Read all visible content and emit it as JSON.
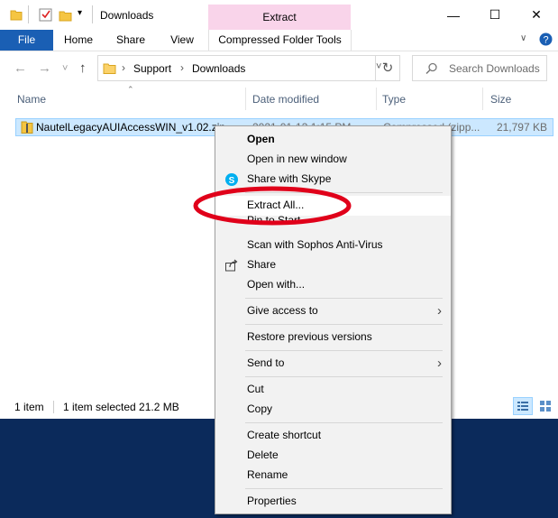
{
  "window": {
    "title": "Downloads",
    "context_header": "Extract",
    "minimize": "—",
    "maximize": "☐",
    "close": "✕"
  },
  "ribbon": {
    "file": "File",
    "home": "Home",
    "share": "Share",
    "view": "View",
    "compressed": "Compressed Folder Tools"
  },
  "address": {
    "back": "←",
    "forward": "→",
    "recent": "˅",
    "up": "↑",
    "crumbs": [
      "Support",
      "Downloads"
    ],
    "sep": "›",
    "dropdown": "˅",
    "refresh": "↻",
    "search_placeholder": "Search Downloads"
  },
  "columns": {
    "name": "Name",
    "date": "Date modified",
    "type": "Type",
    "size": "Size"
  },
  "file": {
    "name": "NautelLegacyAUIAccessWIN_v1.02.zip",
    "date": "2021-01-13 1:15 PM",
    "type": "Compressed (zipp...",
    "size": "21,797 KB"
  },
  "status": {
    "count": "1 item",
    "selected": "1 item selected  21.2 MB"
  },
  "menu": {
    "open": "Open",
    "open_new_window": "Open in new window",
    "share_skype": "Share with Skype",
    "extract_all": "Extract All...",
    "pin_start": "Pin to Start",
    "scan": "Scan with Sophos Anti-Virus",
    "share": "Share",
    "open_with": "Open with...",
    "give_access": "Give access to",
    "restore": "Restore previous versions",
    "send_to": "Send to",
    "cut": "Cut",
    "copy": "Copy",
    "create_shortcut": "Create shortcut",
    "delete": "Delete",
    "rename": "Rename",
    "properties": "Properties",
    "submenu_arrow": "›"
  },
  "colors": {
    "accent": "#1a5fb4",
    "selection": "#cce8ff",
    "context_tab": "#f9d4ea",
    "annotation": "#e0001a",
    "desktop": "#0b2a5b"
  }
}
